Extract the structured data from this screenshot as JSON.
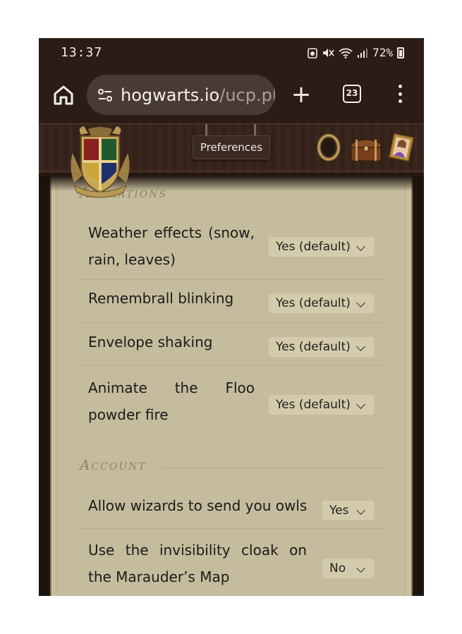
{
  "status_bar": {
    "time": "13:37",
    "battery": "72%"
  },
  "browser": {
    "url_domain": "hogwarts.io",
    "url_path": "/ucp.pl",
    "tab_count": "23"
  },
  "header": {
    "preferences_label": "Preferences"
  },
  "sections": {
    "animations": {
      "title": "Animations",
      "items": [
        {
          "label": "Weather effects (snow, rain, leaves)",
          "value": "Yes (default)"
        },
        {
          "label": "Remembrall blinking",
          "value": "Yes (default)"
        },
        {
          "label": "Envelope shaking",
          "value": "Yes (default)"
        },
        {
          "label": "Animate the Floo powder fire",
          "value": "Yes (default)"
        }
      ]
    },
    "account": {
      "title": "Account",
      "items": [
        {
          "label": "Allow wizards to send you owls",
          "value": "Yes"
        },
        {
          "label": "Use the invisibility cloak on the Marauder’s Map",
          "value": "No"
        }
      ]
    }
  },
  "colors": {
    "chrome_bg": "#2c1c16",
    "parchment": "#c4bc9c",
    "section_title": "#8c8460"
  }
}
